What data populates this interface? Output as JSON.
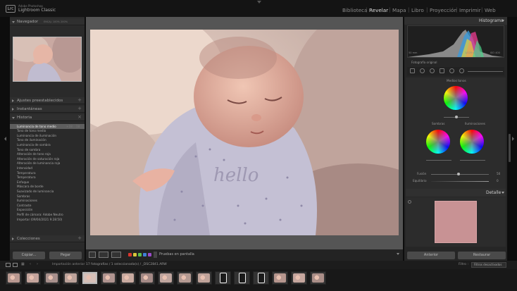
{
  "brand": {
    "company": "Adobe Photoshop",
    "app": "Lightroom Classic",
    "logo_text": "Lrc"
  },
  "modules": [
    {
      "label": "Biblioteca",
      "active": false
    },
    {
      "label": "Revelar",
      "active": true
    },
    {
      "label": "Mapa",
      "active": false
    },
    {
      "label": "Libro",
      "active": false
    },
    {
      "label": "Proyección",
      "active": false
    },
    {
      "label": "Imprimir",
      "active": false
    },
    {
      "label": "Web",
      "active": false
    }
  ],
  "left_panel": {
    "navigator": {
      "title": "Navegador",
      "zoom_options": "ENCAJ.  100%  200%"
    },
    "presets": {
      "title": "Ajustes preestablecidos"
    },
    "snapshots": {
      "title": "Instantáneas"
    },
    "history": {
      "title": "Historia",
      "items": [
        {
          "label": "Luminancia de tono medio",
          "v1": "+18",
          "v2": "18",
          "selected": true
        },
        {
          "label": "Tono de tono medio",
          "v1": "",
          "v2": "",
          "selected": false
        },
        {
          "label": "Luminancia de iluminación",
          "v1": "",
          "v2": "",
          "selected": false
        },
        {
          "label": "Tono de iluminación",
          "v1": "",
          "v2": "",
          "selected": false
        },
        {
          "label": "Luminancia de sombra",
          "v1": "",
          "v2": "",
          "selected": false
        },
        {
          "label": "Tono de sombra",
          "v1": "",
          "v2": "",
          "selected": false
        },
        {
          "label": "Alteración de tono roja",
          "v1": "",
          "v2": "",
          "selected": false
        },
        {
          "label": "Alteración de saturación roja",
          "v1": "",
          "v2": "",
          "selected": false
        },
        {
          "label": "Alteración de luminancia roja",
          "v1": "",
          "v2": "",
          "selected": false
        },
        {
          "label": "Intensidad",
          "v1": "",
          "v2": "",
          "selected": false
        },
        {
          "label": "Temperatura",
          "v1": "",
          "v2": "",
          "selected": false
        },
        {
          "label": "Temperatura",
          "v1": "",
          "v2": "",
          "selected": false
        },
        {
          "label": "Enfoque",
          "v1": "",
          "v2": "",
          "selected": false
        },
        {
          "label": "Máscara de borde",
          "v1": "",
          "v2": "",
          "selected": false
        },
        {
          "label": "Suavizado de luminancia",
          "v1": "",
          "v2": "",
          "selected": false
        },
        {
          "label": "Sombras",
          "v1": "",
          "v2": "",
          "selected": false
        },
        {
          "label": "Iluminaciones",
          "v1": "",
          "v2": "",
          "selected": false
        },
        {
          "label": "Contraste",
          "v1": "",
          "v2": "",
          "selected": false
        },
        {
          "label": "Exposición",
          "v1": "",
          "v2": "",
          "selected": false
        },
        {
          "label": "Perfil de cámara: Adobe Neutro",
          "v1": "",
          "v2": "",
          "selected": false
        },
        {
          "label": "Importar (09/04/2021 9:28:50)",
          "v1": "",
          "v2": "",
          "selected": false
        }
      ]
    },
    "collections": {
      "title": "Colecciones"
    },
    "copy_label": "Copiar...",
    "paste_label": "Pegar"
  },
  "toolbar": {
    "proof_label": "Pruebas en pantalla",
    "color_labels": [
      "#d9362e",
      "#d8c53a",
      "#5cbf4a",
      "#3f7fd8",
      "#9a4bc8"
    ]
  },
  "right_panel": {
    "histogram": {
      "title": "Histograma",
      "info": [
        "50 mm",
        "f/2.8",
        "1/125 s",
        "ISO 400"
      ],
      "original_label": "Fotografía original"
    },
    "color_grading": {
      "midtones_label": "Medios tonos",
      "shadows_label": "Sombras",
      "highlights_label": "Iluminaciones",
      "blend_label": "Fusión",
      "blend_value": "50",
      "balance_label": "Equilibrio",
      "balance_value": "0"
    },
    "detail": {
      "title": "Detalle"
    },
    "prev_label": "Anterior",
    "reset_label": "Restaurar"
  },
  "filmstrip": {
    "source": "Importación anterior",
    "path": "17 fotografías / 1 seleccionada(s) / _DSC2841.ARW",
    "filter_label": "Filtro :",
    "filter_value": "Filtros desactivados",
    "thumb_count": 17,
    "selected_index": 4
  },
  "colors": {
    "accent_selected": "#5e5e5e",
    "panel_bg": "#2a2a2a",
    "background": "#0d0d0d"
  }
}
